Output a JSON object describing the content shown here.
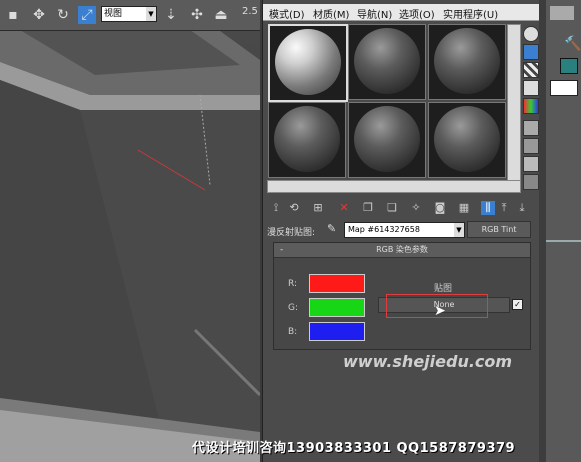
{
  "viewport": {
    "view_dropdown": "视图",
    "toolbar_number": "2.5"
  },
  "material_editor": {
    "menus": [
      "模式(D)",
      "材质(M)",
      "导航(N)",
      "选项(O)",
      "实用程序(U)"
    ],
    "map_label": "漫反射贴图:",
    "map_name": "Map #6143276​58",
    "map_type_button": "RGB Tint",
    "rollout": {
      "title": "RGB 染色参数",
      "collapse_symbol": "-",
      "channels": [
        {
          "label": "R:",
          "color": "#ff1a1a"
        },
        {
          "label": "G:",
          "color": "#16d616"
        },
        {
          "label": "B:",
          "color": "#1e1ef0"
        }
      ],
      "maps_title": "贴图",
      "map_slot_label": "None"
    }
  },
  "watermark": "www.shejiedu.com",
  "footer": "代设计培训咨询13903833301 QQ1587879379"
}
